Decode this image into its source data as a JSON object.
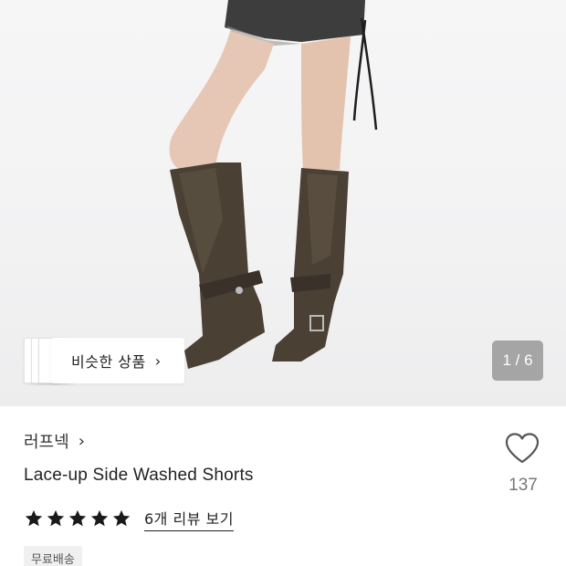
{
  "gallery": {
    "similar_button_label": "비슷한 상품",
    "similar_button_chevron": "›",
    "pager_text": "1 / 6"
  },
  "product": {
    "brand": "러프넥",
    "brand_chevron": "›",
    "title": "Lace-up Side Washed Shorts",
    "like_count": "137",
    "rating_stars": 5,
    "review_link": "6개 리뷰 보기",
    "shipping_badge": "무료배송"
  },
  "colors": {
    "boot": "#4a4034",
    "skin": "#e6c7b5",
    "shorts": "#3d3d3d",
    "star": "#1a1a1a"
  },
  "icons": {
    "like": "heart-outline-icon",
    "star": "star-icon",
    "chevron": "chevron-right-icon"
  }
}
